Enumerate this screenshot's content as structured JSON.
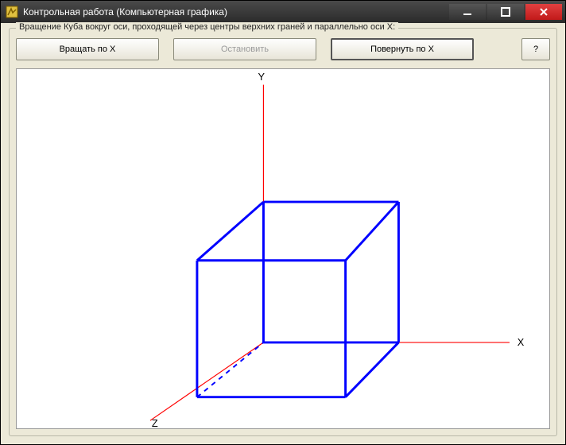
{
  "window": {
    "title": "Контрольная работа (Компьютерная графика)"
  },
  "groupbox": {
    "legend": "Вращение Куба вокруг оси, проходящей через центры верхних граней и параллельно оси X:"
  },
  "buttons": {
    "rotate": "Вращать по X",
    "stop": "Остановить",
    "turn": "Повернуть по X",
    "help": "?"
  },
  "axes": {
    "x": "X",
    "y": "Y",
    "z": "Z"
  },
  "chart_data": {
    "type": "diagram-3d",
    "title": "Wireframe cube with XYZ axes",
    "axes": [
      {
        "name": "X",
        "color": "#ff0000",
        "direction": "right"
      },
      {
        "name": "Y",
        "color": "#ff0000",
        "direction": "up"
      },
      {
        "name": "Z",
        "color": "#ff0000",
        "direction": "down-left"
      }
    ],
    "cube": {
      "edge_color": "#0000ff",
      "hidden_edge_style": "dashed",
      "vertices_2d": {
        "A": [
          305,
          350
        ],
        "B": [
          478,
          350
        ],
        "C": [
          410,
          420
        ],
        "D": [
          220,
          420
        ],
        "E": [
          305,
          170
        ],
        "F": [
          478,
          170
        ],
        "G": [
          410,
          245
        ],
        "H": [
          220,
          245
        ]
      },
      "edges": [
        [
          "A",
          "B",
          "solid"
        ],
        [
          "B",
          "C",
          "solid"
        ],
        [
          "C",
          "D",
          "solid"
        ],
        [
          "D",
          "A",
          "dashed"
        ],
        [
          "E",
          "F",
          "solid"
        ],
        [
          "F",
          "G",
          "solid"
        ],
        [
          "G",
          "H",
          "solid"
        ],
        [
          "H",
          "E",
          "solid"
        ],
        [
          "A",
          "E",
          "solid"
        ],
        [
          "B",
          "F",
          "solid"
        ],
        [
          "C",
          "G",
          "solid"
        ],
        [
          "D",
          "H",
          "solid"
        ]
      ]
    }
  }
}
